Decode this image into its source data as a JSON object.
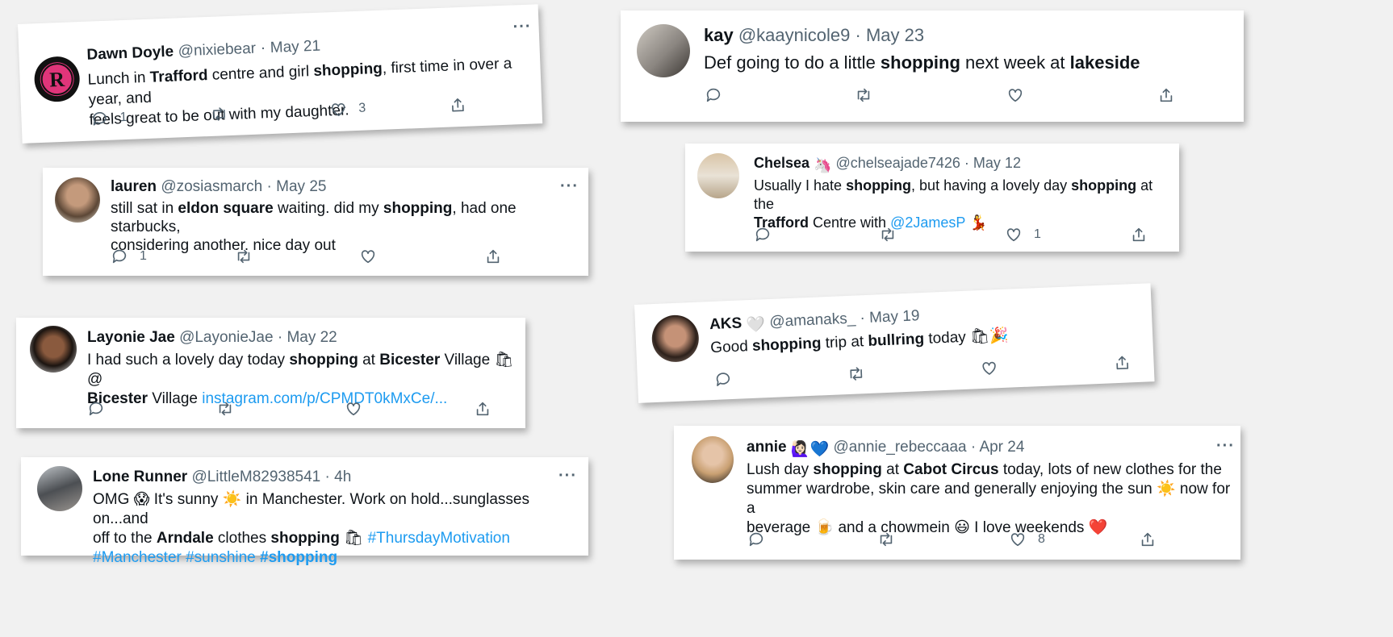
{
  "tweets": [
    {
      "id": "dawn",
      "name": "Dawn Doyle",
      "handle": "@nixiebear",
      "sep": "·",
      "date": "May 21",
      "body": [
        [
          {
            "t": "Lunch in "
          },
          {
            "t": "Trafford",
            "b": true
          },
          {
            "t": " centre and girl "
          },
          {
            "t": "shopping",
            "b": true
          },
          {
            "t": ", first time in over a year, and"
          }
        ],
        [
          {
            "t": "feels great to be out with my daughter."
          }
        ]
      ],
      "reply_count": "1",
      "like_count": "3"
    },
    {
      "id": "kay",
      "name": "kay",
      "handle": "@kaaynicole9",
      "sep": "·",
      "date": "May 23",
      "body": [
        [
          {
            "t": "Def going to do a little "
          },
          {
            "t": "shopping",
            "b": true
          },
          {
            "t": " next week at "
          },
          {
            "t": "lakeside",
            "b": true
          }
        ]
      ]
    },
    {
      "id": "lauren",
      "name": "lauren",
      "handle": "@zosiasmarch",
      "sep": "·",
      "date": "May 25",
      "body": [
        [
          {
            "t": "still sat in "
          },
          {
            "t": "eldon square",
            "b": true
          },
          {
            "t": " waiting. did my "
          },
          {
            "t": "shopping",
            "b": true
          },
          {
            "t": ", had one starbucks,"
          }
        ],
        [
          {
            "t": "considering another. nice day out"
          }
        ]
      ],
      "reply_count": "1"
    },
    {
      "id": "chelsea",
      "name": "Chelsea",
      "name_emoji": "🦄",
      "handle": "@chelseajade7426",
      "sep": "·",
      "date": "May 12",
      "body": [
        [
          {
            "t": "Usually I hate "
          },
          {
            "t": "shopping",
            "b": true
          },
          {
            "t": ", but having a lovely day "
          },
          {
            "t": "shopping",
            "b": true
          },
          {
            "t": " at the"
          }
        ],
        [
          {
            "t": "Trafford",
            "b": true
          },
          {
            "t": " Centre with "
          },
          {
            "t": "@2JamesP",
            "l": true
          },
          {
            "t": " 💃"
          }
        ]
      ],
      "like_count": "1"
    },
    {
      "id": "layonie",
      "name": "Layonie Jae",
      "handle": "@LayonieJae",
      "sep": "·",
      "date": "May 22",
      "body": [
        [
          {
            "t": "I had such a lovely day today "
          },
          {
            "t": "shopping",
            "b": true
          },
          {
            "t": " at "
          },
          {
            "t": "Bicester",
            "b": true
          },
          {
            "t": " Village 🛍 @"
          }
        ],
        [
          {
            "t": "Bicester",
            "b": true
          },
          {
            "t": " Village "
          },
          {
            "t": "instagram.com/p/CPMDT0kMxCe/...",
            "l": true
          }
        ]
      ]
    },
    {
      "id": "aks",
      "name": "AKS",
      "name_emoji": "🤍",
      "handle": "@amanaks_",
      "sep": "·",
      "date": "May 19",
      "body": [
        [
          {
            "t": "Good "
          },
          {
            "t": "shopping",
            "b": true
          },
          {
            "t": " trip at "
          },
          {
            "t": "bullring",
            "b": true
          },
          {
            "t": " today 🛍🎉"
          }
        ]
      ]
    },
    {
      "id": "lone",
      "name": "Lone Runner",
      "handle": "@LittleM82938541",
      "sep": "·",
      "date": "4h",
      "body": [
        [
          {
            "t": "OMG 😱 It's sunny ☀️ in Manchester. Work on hold...sunglasses on...and"
          }
        ],
        [
          {
            "t": "off to the "
          },
          {
            "t": "Arndale",
            "b": true
          },
          {
            "t": " clothes "
          },
          {
            "t": "shopping",
            "b": true
          },
          {
            "t": " 🛍 "
          },
          {
            "t": "#ThursdayMotivation",
            "l": true
          }
        ],
        [
          {
            "t": "#Manchester #sunshine ",
            "l": true
          },
          {
            "t": "#shopping",
            "l": true,
            "b": true
          }
        ]
      ]
    },
    {
      "id": "annie",
      "name": "annie",
      "name_emoji": "🙋🏻‍♀️💙",
      "handle": "@annie_rebeccaaa",
      "sep": "·",
      "date": "Apr 24",
      "body": [
        [
          {
            "t": "Lush day "
          },
          {
            "t": "shopping",
            "b": true
          },
          {
            "t": " at "
          },
          {
            "t": "Cabot Circus",
            "b": true
          },
          {
            "t": " today, lots of new clothes for the"
          }
        ],
        [
          {
            "t": "summer wardrobe, skin care and generally enjoying the sun ☀️ now for a"
          }
        ],
        [
          {
            "t": "beverage 🍺 and a chowmein 😃 I love weekends ❤️"
          }
        ]
      ],
      "like_count": "8"
    }
  ],
  "icons": {
    "reply": "reply-icon",
    "retweet": "retweet-icon",
    "like": "heart-icon",
    "share": "share-icon",
    "more": "more-icon"
  },
  "more_label": "···",
  "colors": {
    "link": "#1d9bf0",
    "muted": "#536471",
    "text": "#0f1419",
    "background": "#f1f1f1"
  }
}
